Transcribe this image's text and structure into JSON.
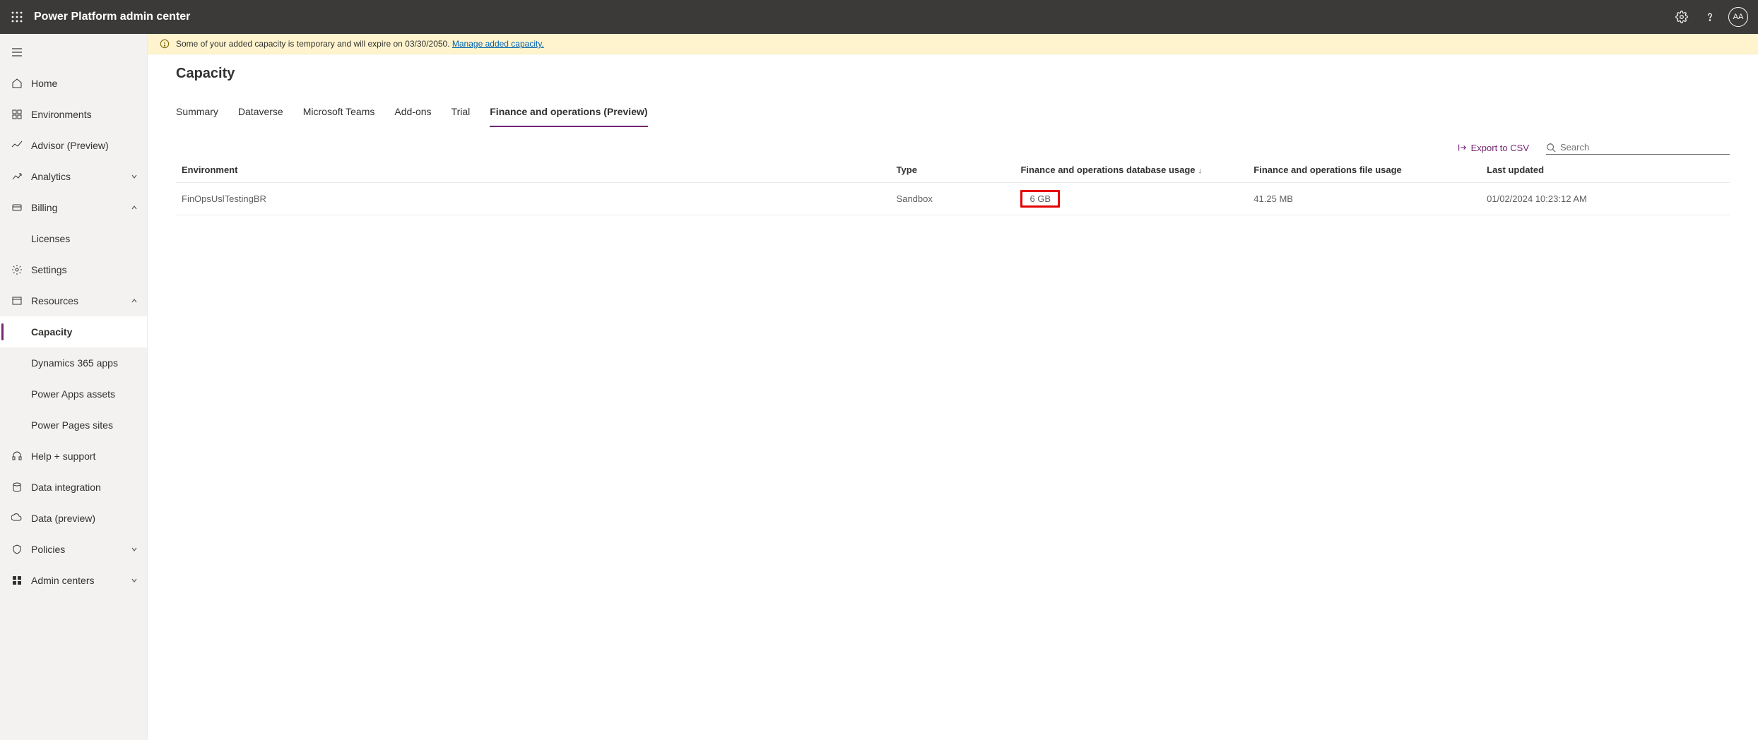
{
  "header": {
    "title": "Power Platform admin center",
    "avatar_initials": "AA"
  },
  "banner": {
    "text_prefix": "Some of your added capacity is temporary and will expire on 03/30/2050. ",
    "link": "Manage added capacity."
  },
  "sidebar": {
    "home": "Home",
    "environments": "Environments",
    "advisor": "Advisor (Preview)",
    "analytics": "Analytics",
    "billing": "Billing",
    "licenses": "Licenses",
    "settings": "Settings",
    "resources": "Resources",
    "capacity": "Capacity",
    "d365apps": "Dynamics 365 apps",
    "powerapps_assets": "Power Apps assets",
    "powerpages": "Power Pages sites",
    "help": "Help + support",
    "data_integration": "Data integration",
    "data_preview": "Data (preview)",
    "policies": "Policies",
    "admin_centers": "Admin centers"
  },
  "page": {
    "title": "Capacity",
    "tabs": {
      "summary": "Summary",
      "dataverse": "Dataverse",
      "teams": "Microsoft Teams",
      "addons": "Add-ons",
      "trial": "Trial",
      "fno": "Finance and operations (Preview)"
    },
    "export_label": "Export to CSV",
    "search_placeholder": "Search"
  },
  "table": {
    "cols": {
      "environment": "Environment",
      "type": "Type",
      "db_usage": "Finance and operations database usage",
      "file_usage": "Finance and operations file usage",
      "last_updated": "Last updated"
    },
    "rows": [
      {
        "environment": "FinOpsUslTestingBR",
        "type": "Sandbox",
        "db_usage": "6 GB",
        "file_usage": "41.25 MB",
        "last_updated": "01/02/2024 10:23:12 AM"
      }
    ]
  }
}
